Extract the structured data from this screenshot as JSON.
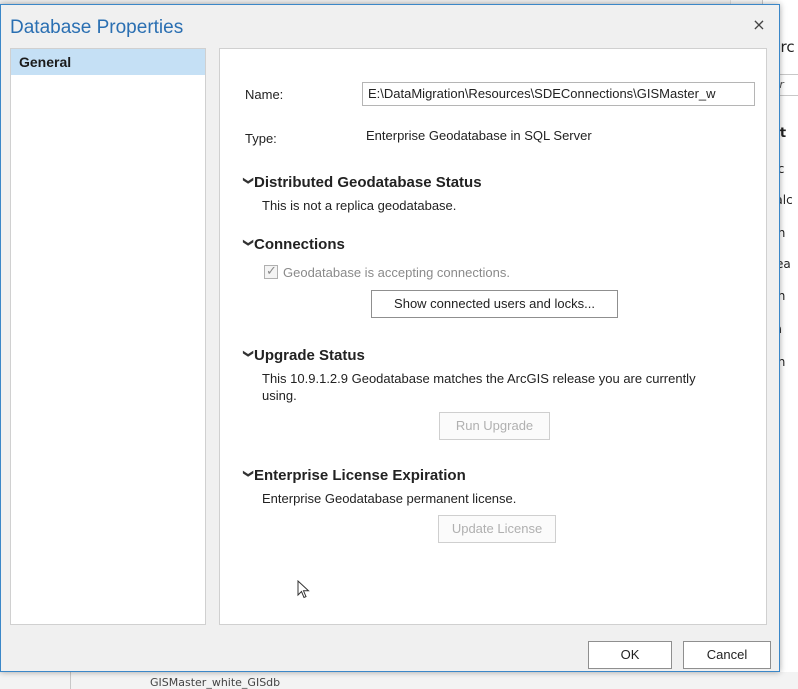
{
  "background": {
    "right_fragments": [
      "ts",
      "prc",
      "Fir",
      "rit",
      "jec",
      "Calc",
      "ain",
      "Nea",
      "ain",
      "pa",
      "ain"
    ],
    "bottom_text": "GISMaster_white_GISdb"
  },
  "dialog": {
    "title": "Database Properties",
    "close_symbol": "×"
  },
  "nav": {
    "items": [
      {
        "label": "General",
        "selected": true
      }
    ]
  },
  "general": {
    "name_label": "Name:",
    "name_value": "E:\\DataMigration\\Resources\\SDEConnections\\GISMaster_w",
    "type_label": "Type:",
    "type_value": "Enterprise Geodatabase in SQL Server",
    "distributed": {
      "heading": "Distributed Geodatabase Status",
      "text": "This is not a replica geodatabase."
    },
    "connections": {
      "heading": "Connections",
      "checkbox_label": "Geodatabase is accepting connections.",
      "checkbox_checked": true,
      "show_users_button": "Show connected users and locks..."
    },
    "upgrade": {
      "heading": "Upgrade Status",
      "text_line1": "This 10.9.1.2.9 Geodatabase matches the ArcGIS release you are currently",
      "text_line2": "using.",
      "run_upgrade_button": "Run Upgrade"
    },
    "license": {
      "heading": "Enterprise License Expiration",
      "text": "Enterprise Geodatabase permanent license.",
      "update_license_button": "Update License"
    }
  },
  "footer": {
    "ok_label": "OK",
    "cancel_label": "Cancel"
  },
  "colors": {
    "title": "#2a6fb2",
    "selected_nav": "#c5e0f5",
    "dialog_border": "#3b87c8"
  }
}
